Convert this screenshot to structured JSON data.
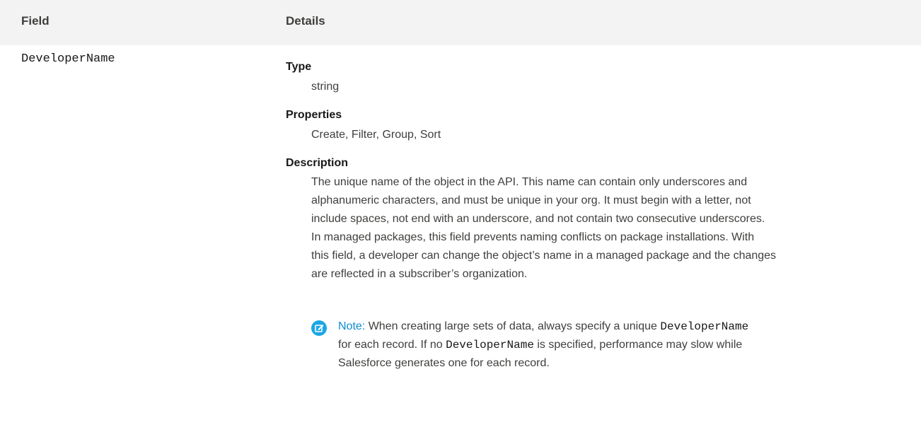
{
  "table": {
    "header": {
      "field": "Field",
      "details": "Details"
    },
    "row": {
      "field_name": "DeveloperName",
      "type_label": "Type",
      "type_value": "string",
      "properties_label": "Properties",
      "properties_value": "Create, Filter, Group, Sort",
      "description_label": "Description",
      "description_lines": [
        "The unique name of the object in the API. This name can contain only underscores and",
        "alphanumeric characters, and must be unique in your org. It must begin with a letter, not",
        "include spaces, not end with an underscore, and not contain two consecutive underscores.",
        "In managed packages, this field prevents naming conflicts on package installations. With",
        "this field, a developer can change the object’s name in a managed package and the changes",
        "are reflected in a subscriber’s organization."
      ],
      "note": {
        "icon": "edit-note-icon",
        "label": "Note:",
        "line1_part1": "When creating large sets of data, always specify a unique",
        "line1_code": "DeveloperName",
        "line2_part1": "for each record. If no",
        "line2_code": "DeveloperName",
        "line2_part2": "is specified, performance may slow while",
        "line3": "Salesforce generates one for each record."
      }
    }
  },
  "colors": {
    "header_bg": "#f3f3f3",
    "note_icon": "#1ca6e6",
    "note_label": "#0b8bd2"
  }
}
